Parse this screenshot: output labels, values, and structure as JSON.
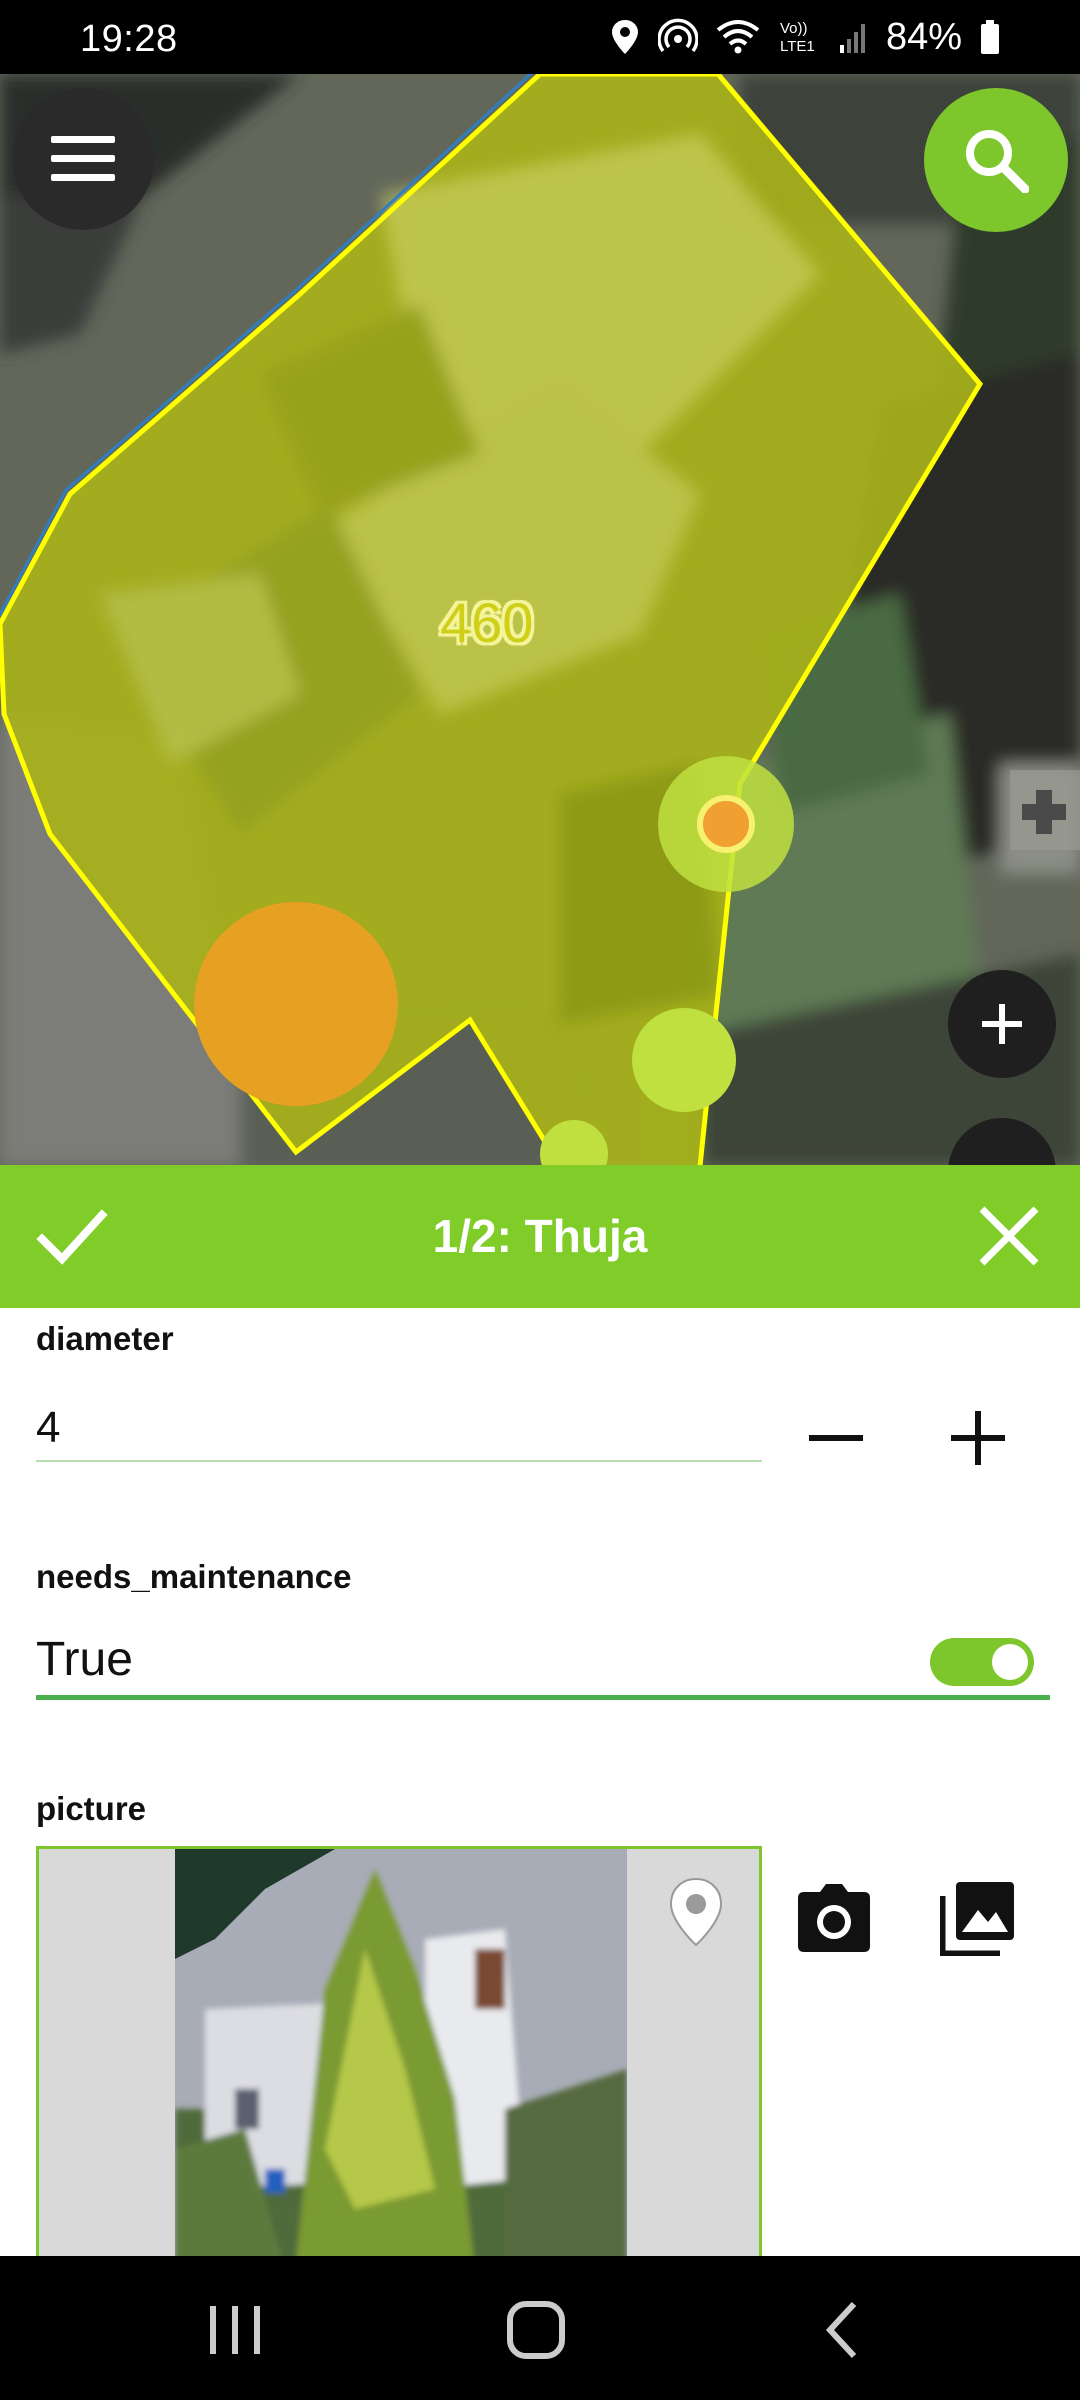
{
  "status_bar": {
    "time": "19:28",
    "battery": "84%",
    "icons": [
      "location-icon",
      "hotspot-icon",
      "wifi-icon",
      "volte-icon",
      "signal-icon",
      "battery-icon"
    ]
  },
  "map": {
    "feature_label": "460",
    "buttons": {
      "menu": "menu-icon",
      "search": "search-icon",
      "zoom_in": "plus-icon"
    },
    "colors": {
      "polygon_fill": "#a8b21a",
      "polygon_stroke": "#ffff00",
      "point_orange": "#e6a022",
      "point_green": "#c0e040",
      "accent": "#7dc62c"
    }
  },
  "title_bar": {
    "title": "1/2: Thuja",
    "ok_icon": "check-icon",
    "close_icon": "close-icon"
  },
  "form": {
    "diameter": {
      "label": "diameter",
      "value": "4"
    },
    "needs_maintenance": {
      "label": "needs_maintenance",
      "value": "True",
      "checked": true
    },
    "picture": {
      "label": "picture"
    }
  }
}
